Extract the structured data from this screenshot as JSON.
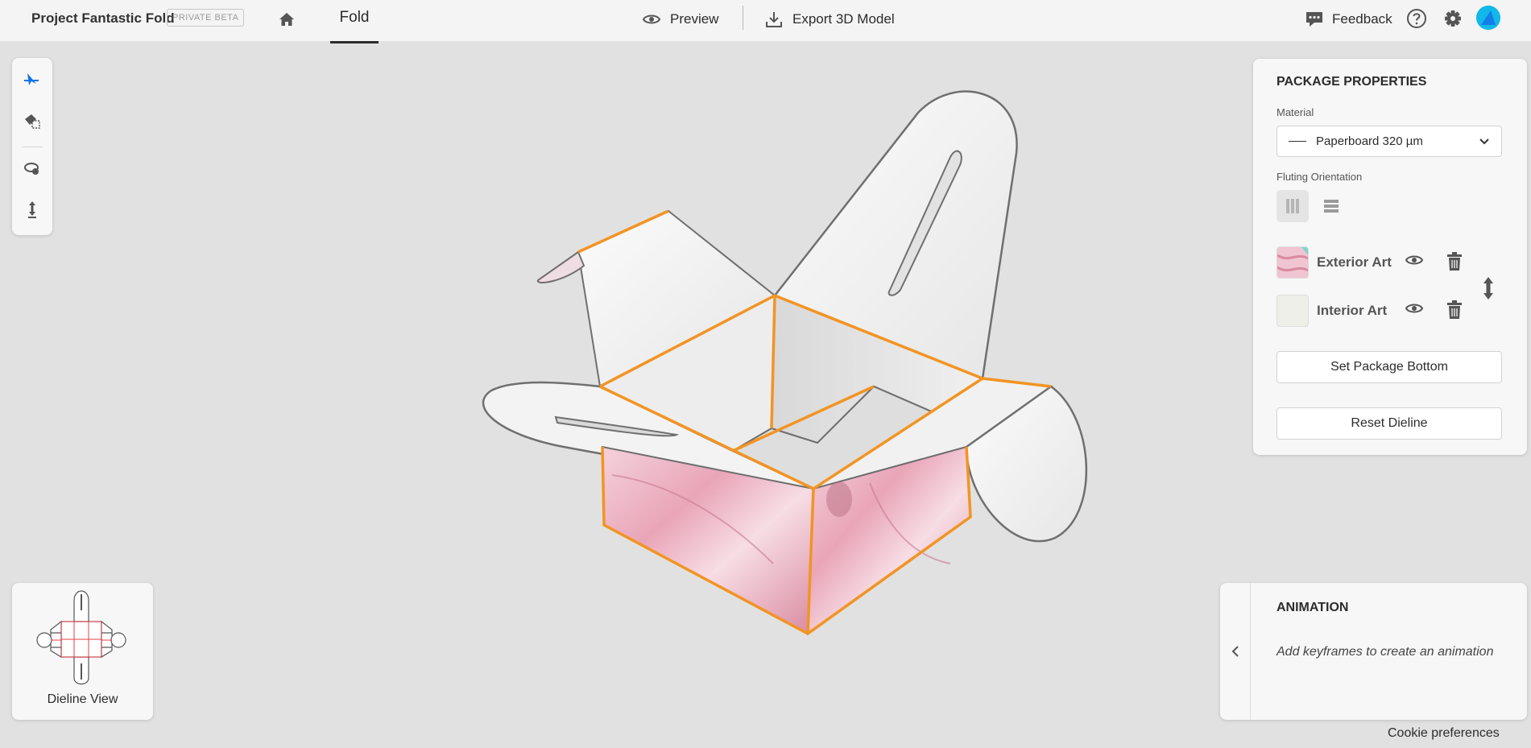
{
  "header": {
    "app_title": "Project Fantastic Fold",
    "badge": "PRIVATE BETA",
    "tab_active": "Fold",
    "preview_label": "Preview",
    "export_label": "Export 3D Model",
    "feedback_label": "Feedback"
  },
  "toolbar": {
    "tools": [
      "select-fold-icon",
      "paint-art-icon",
      "orbit-icon",
      "move-vertical-icon"
    ]
  },
  "properties": {
    "title": "PACKAGE PROPERTIES",
    "material_label": "Material",
    "material_value": "Paperboard 320 µm",
    "fluting_label": "Fluting Orientation",
    "exterior_art": "Exterior Art",
    "interior_art": "Interior Art",
    "set_bottom_label": "Set Package Bottom",
    "reset_label": "Reset Dieline"
  },
  "dieline": {
    "label": "Dieline View"
  },
  "animation": {
    "title": "ANIMATION",
    "hint": "Add keyframes to create an animation"
  },
  "footer": {
    "cookie_label": "Cookie preferences"
  },
  "colors": {
    "accent_blue": "#1473e6",
    "fold_orange": "#f29423",
    "avatar": "#11b8e8"
  }
}
